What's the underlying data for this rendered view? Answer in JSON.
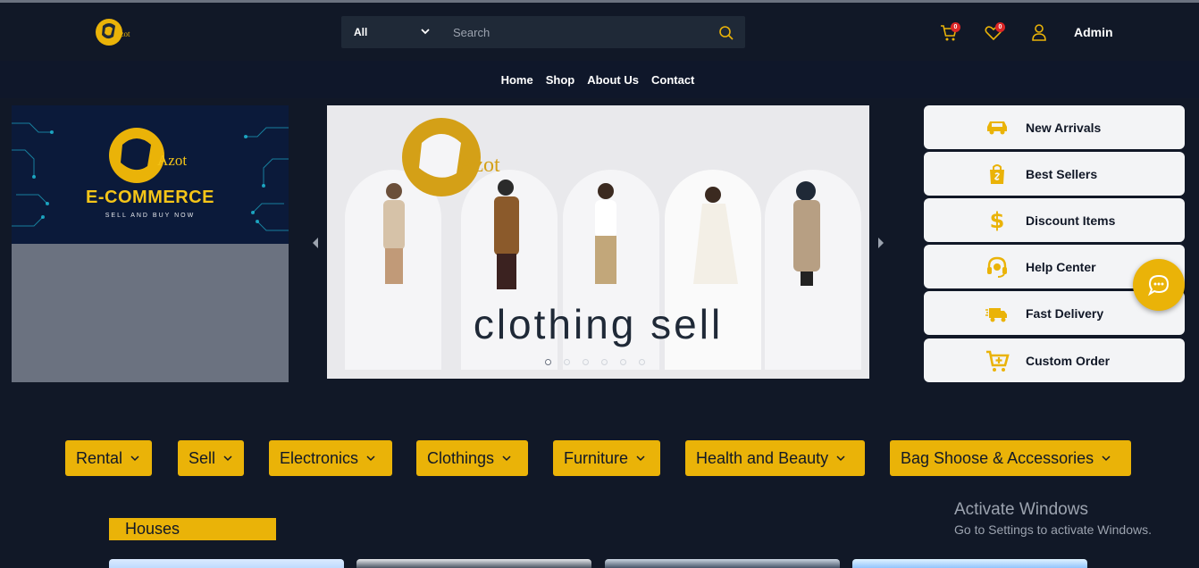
{
  "header": {
    "logo_text": "Azot",
    "search": {
      "category": "All",
      "placeholder": "Search"
    },
    "cart_count": "0",
    "wishlist_count": "0",
    "user_label": "Admin"
  },
  "nav": {
    "items": [
      "Home",
      "Shop",
      "About Us",
      "Contact"
    ]
  },
  "promo": {
    "brand": "Azot",
    "title": "E-COMMERCE",
    "subtitle": "SELL AND BUY NOW"
  },
  "carousel": {
    "brand": "Azot",
    "caption": "clothing sell",
    "slide_count": 6,
    "active_slide": 1
  },
  "side_menu": [
    {
      "label": "New Arrivals",
      "icon": "car-icon"
    },
    {
      "label": "Best Sellers",
      "icon": "shopping-bag-icon"
    },
    {
      "label": "Discount Items",
      "icon": "dollar-icon"
    },
    {
      "label": "Help Center",
      "icon": "headset-icon"
    },
    {
      "label": "Fast Delivery",
      "icon": "truck-icon"
    },
    {
      "label": "Custom Order",
      "icon": "cart-plus-icon"
    }
  ],
  "categories": [
    "Rental",
    "Sell",
    "Electronics",
    "Clothings",
    "Furniture",
    "Health and Beauty",
    "Bag Shoose & Accessories"
  ],
  "section": {
    "title": "Houses"
  },
  "windows_watermark": {
    "line1": "Activate Windows",
    "line2": "Go to Settings to activate Windows."
  },
  "colors": {
    "accent": "#eab308",
    "background": "#111827",
    "badge": "#dc2626"
  }
}
